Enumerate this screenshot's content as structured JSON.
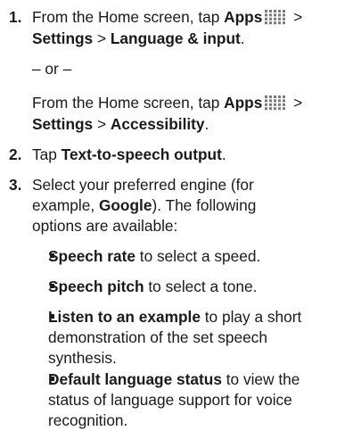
{
  "steps": [
    {
      "number": "1.",
      "line1": {
        "prefix": "From the Home screen, tap ",
        "bold": "Apps",
        "suffix": " >"
      },
      "line2": {
        "bold1": "Settings",
        "sep": " > ",
        "bold2": "Language & input",
        "end": "."
      },
      "or": "– or –",
      "alt_line1": {
        "prefix": "From the Home screen, tap ",
        "bold": "Apps",
        "suffix": " >"
      },
      "alt_line2": {
        "bold1": "Settings",
        "sep": " > ",
        "bold2": "Accessibility",
        "end": "."
      }
    },
    {
      "number": "2.",
      "prefix": "Tap ",
      "bold": "Text-to-speech output",
      "end": "."
    },
    {
      "number": "3.",
      "line1": "Select your preferred engine (for",
      "line2": {
        "prefix": "example, ",
        "bold": "Google",
        "suffix": "). The following"
      },
      "line3": "options are available:"
    }
  ],
  "bullets": [
    {
      "bold": "Speech rate",
      "rest": [
        " to select a speed."
      ]
    },
    {
      "bold": "Speech pitch",
      "rest": [
        " to select a tone."
      ]
    },
    {
      "bold": "Listen to an example",
      "rest": [
        " to play a short",
        "demonstration of the set speech",
        "synthesis."
      ]
    },
    {
      "bold": "Default language status",
      "rest": [
        " to view the",
        "status of language support for voice",
        "recognition."
      ]
    }
  ],
  "icon": {
    "name": "apps-grid-icon",
    "color": "#7a7a7a"
  }
}
